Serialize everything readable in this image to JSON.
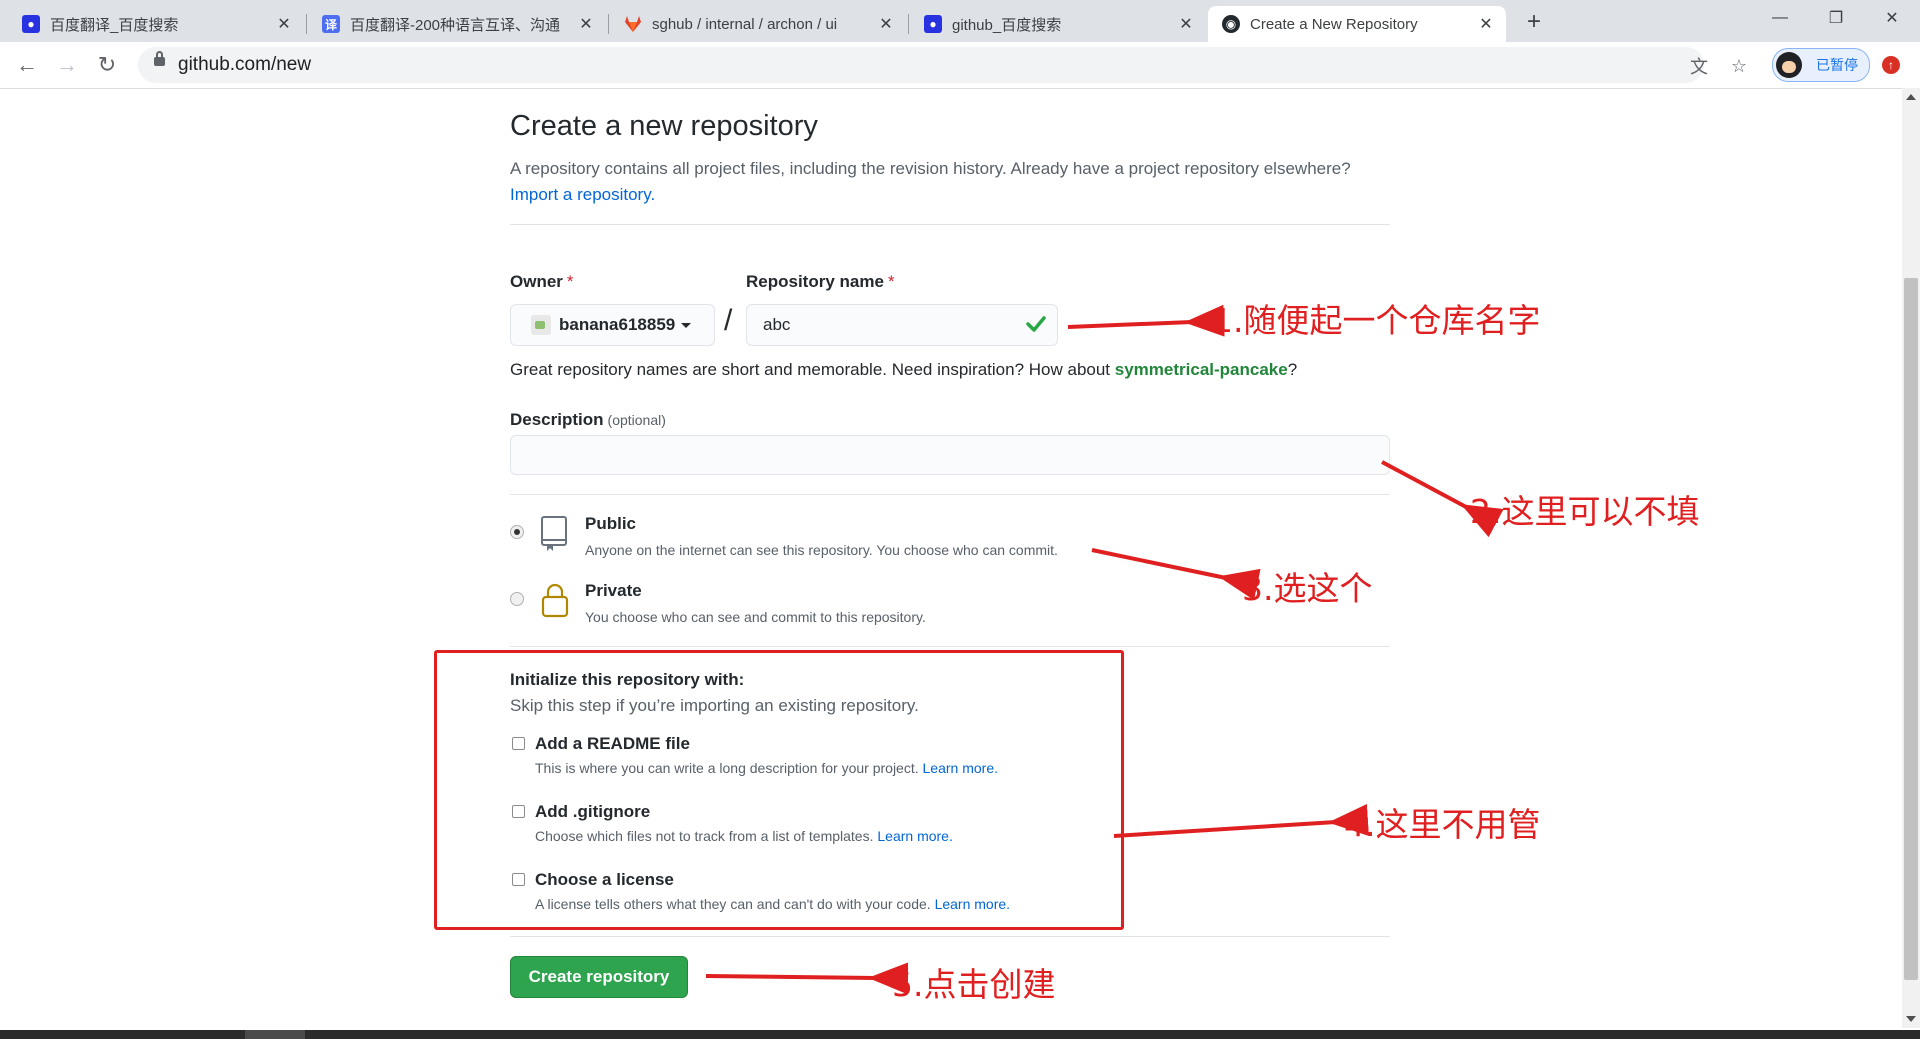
{
  "browser": {
    "tabs": [
      {
        "title": "百度翻译_百度搜索",
        "icon": "baidu-paw-icon",
        "active": false
      },
      {
        "title": "百度翻译-200种语言互译、沟通",
        "icon": "baidu-translate-icon",
        "active": false
      },
      {
        "title": "sghub / internal / archon / ui",
        "icon": "gitlab-icon",
        "active": false
      },
      {
        "title": "github_百度搜索",
        "icon": "baidu-paw-icon",
        "active": false
      },
      {
        "title": "Create a New Repository",
        "icon": "github-icon",
        "active": true
      }
    ],
    "url": "github.com/new",
    "profile_label": "已暂停"
  },
  "page": {
    "title": "Create a new repository",
    "subtitle": "A repository contains all project files, including the revision history. Already have a project repository elsewhere?",
    "import_link": "Import a repository.",
    "owner_label": "Owner",
    "owner_value": "banana618859",
    "repo_name_label": "Repository name",
    "repo_name_value": "abc",
    "required_mark": "*",
    "name_hint_prefix": "Great repository names are short and memorable. Need inspiration? How about ",
    "name_hint_suggestion": "symmetrical-pancake",
    "name_hint_suffix": "?",
    "description_label": "Description",
    "description_optional": "(optional)",
    "description_value": "",
    "visibility": [
      {
        "title": "Public",
        "desc": "Anyone on the internet can see this repository. You choose who can commit.",
        "checked": true
      },
      {
        "title": "Private",
        "desc": "You choose who can see and commit to this repository.",
        "checked": false
      }
    ],
    "init_title": "Initialize this repository with:",
    "init_sub": "Skip this step if you’re importing an existing repository.",
    "init_options": [
      {
        "title": "Add a README file",
        "desc": "This is where you can write a long description for your project.",
        "link": "Learn more."
      },
      {
        "title": "Add .gitignore",
        "desc": "Choose which files not to track from a list of templates.",
        "link": "Learn more."
      },
      {
        "title": "Choose a license",
        "desc": "A license tells others what they can and can't do with your code.",
        "link": "Learn more."
      }
    ],
    "create_button": "Create repository"
  },
  "annotations": {
    "a1": "1.随便起一个仓库名字",
    "a2": "2.这里可以不填",
    "a3": "3.选这个",
    "a4": "4.这里不用管",
    "a5": "5.点击创建",
    "color": "#e02020"
  },
  "colors": {
    "link": "#0366d6",
    "primary_button": "#2ea44f",
    "suggestion": "#22863a",
    "valid_check": "#28a745"
  }
}
